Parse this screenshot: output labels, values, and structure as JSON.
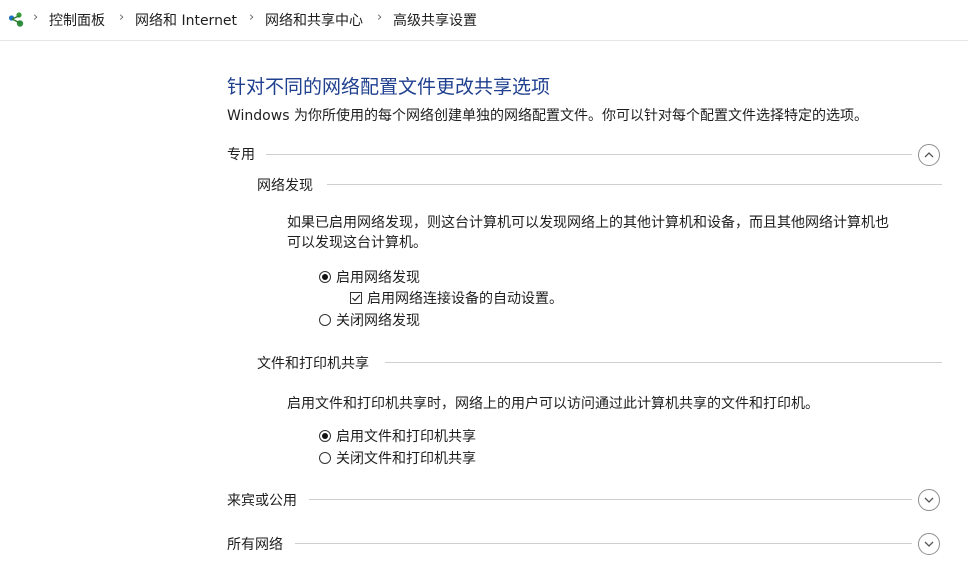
{
  "breadcrumb": {
    "items": [
      "控制面板",
      "网络和 Internet",
      "网络和共享中心",
      "高级共享设置"
    ]
  },
  "page": {
    "title": "针对不同的网络配置文件更改共享选项",
    "description": "Windows 为你所使用的每个网络创建单独的网络配置文件。你可以针对每个配置文件选择特定的选项。"
  },
  "sections": {
    "private": {
      "label": "专用",
      "expanded": true,
      "network_discovery": {
        "label": "网络发现",
        "text_line1": "如果已启用网络发现，则这台计算机可以发现网络上的其他计算机和设备，而且其他网络计算机也",
        "text_line2": "可以发现这台计算机。",
        "on_label": "启用网络发现",
        "auto_setup_label": "启用网络连接设备的自动设置。",
        "off_label": "关闭网络发现",
        "selected": "on",
        "auto_setup_checked": true
      },
      "file_printer": {
        "label": "文件和打印机共享",
        "text": "启用文件和打印机共享时，网络上的用户可以访问通过此计算机共享的文件和打印机。",
        "on_label": "启用文件和打印机共享",
        "off_label": "关闭文件和打印机共享",
        "selected": "on"
      }
    },
    "guest": {
      "label": "来宾或公用",
      "expanded": false
    },
    "all": {
      "label": "所有网络",
      "expanded": false
    }
  },
  "colors": {
    "title": "#1f3f8f",
    "rule": "#cfcfcf"
  }
}
